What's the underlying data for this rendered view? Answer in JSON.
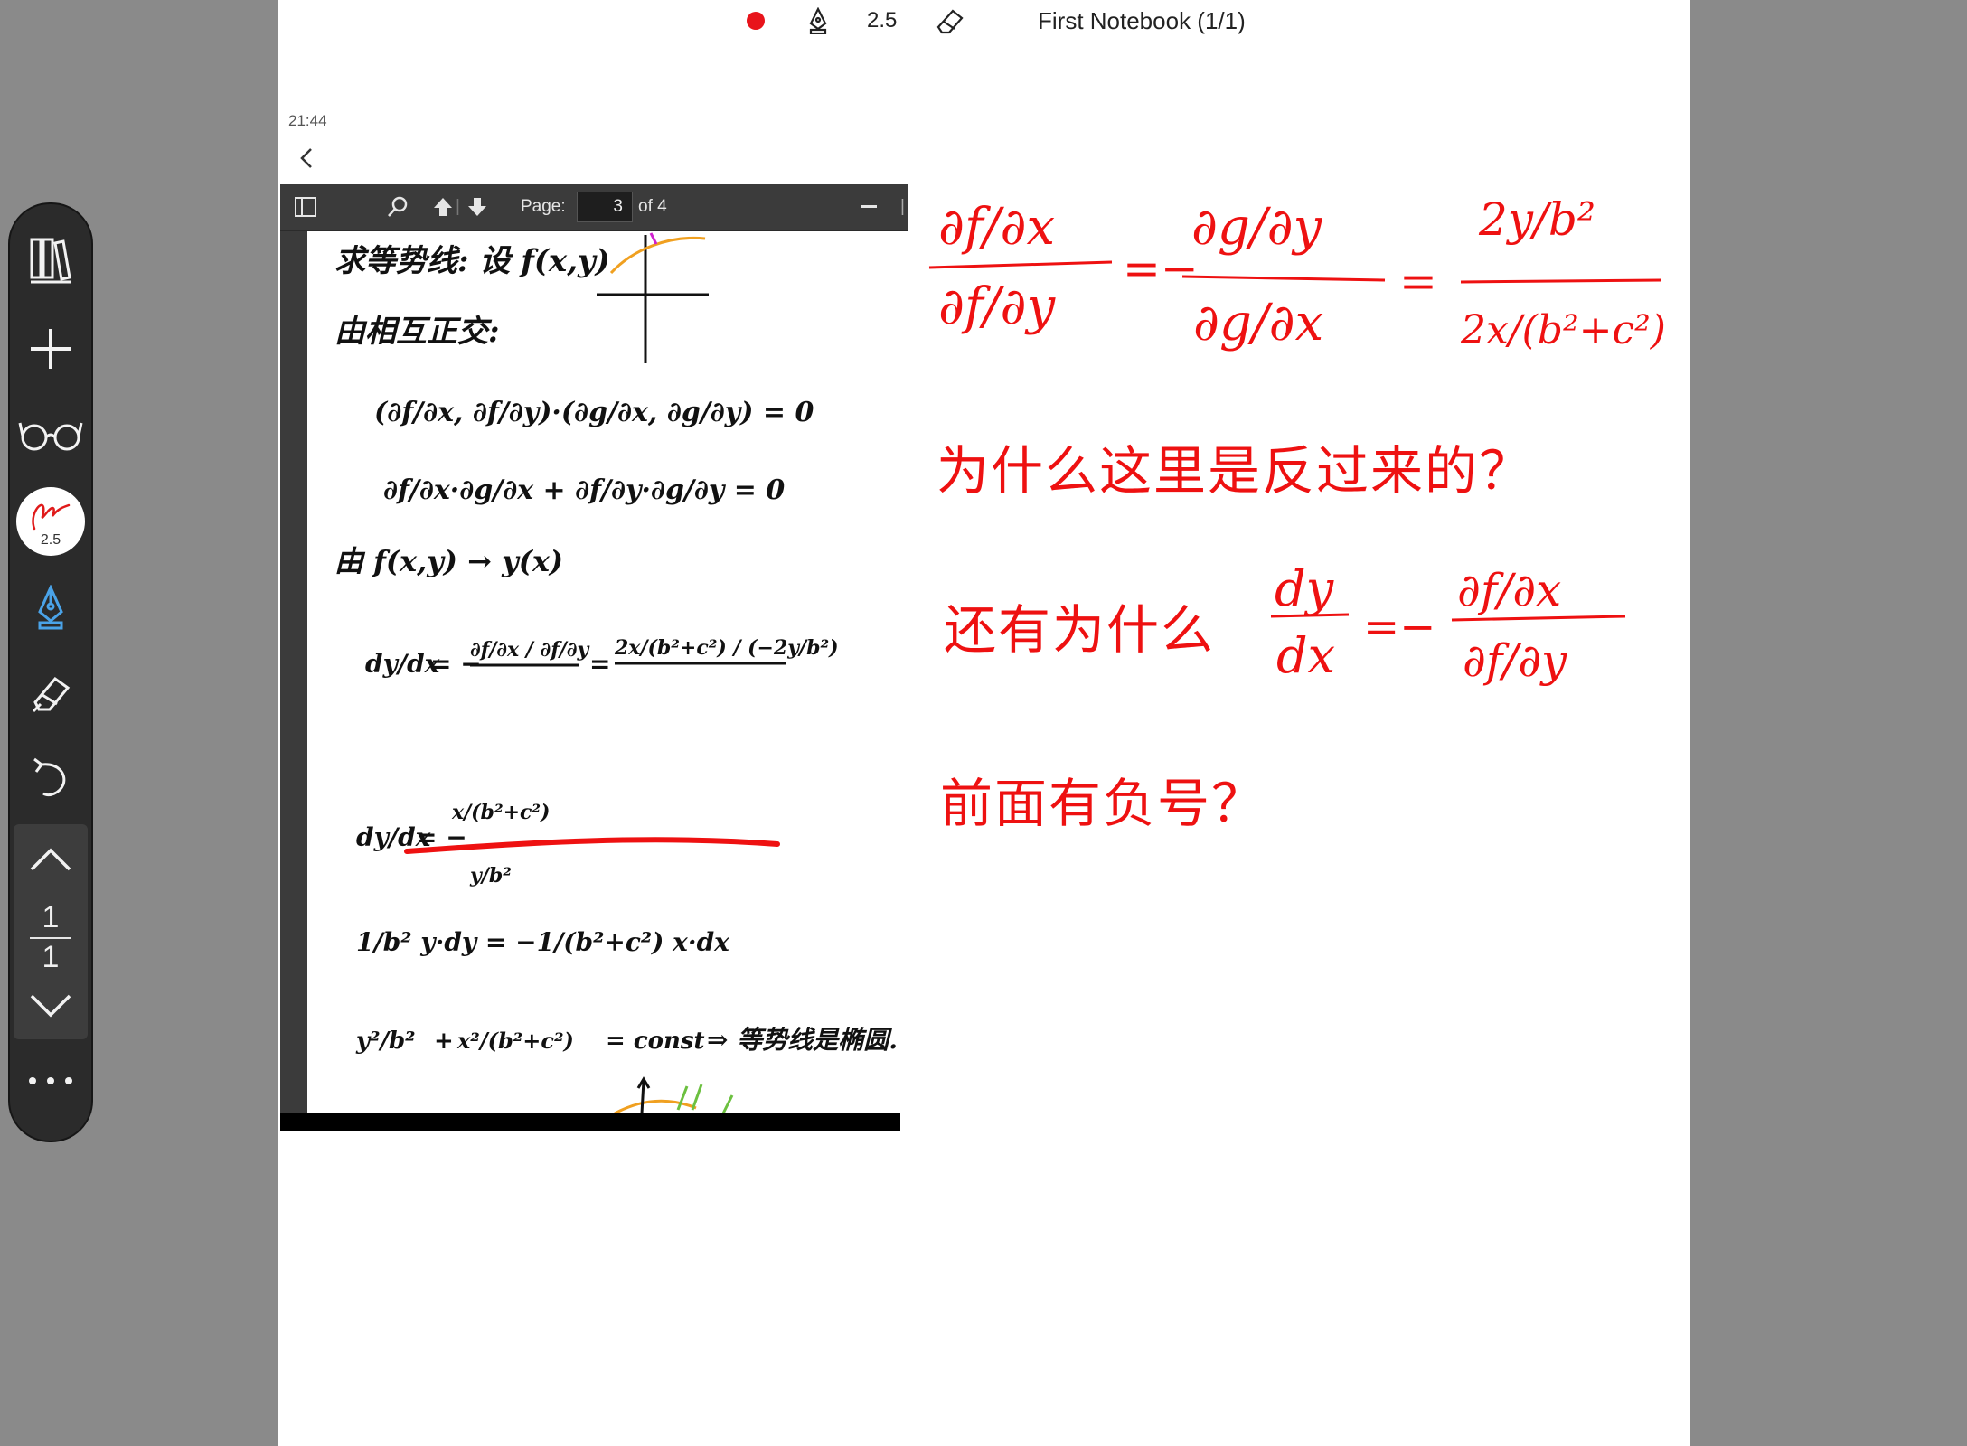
{
  "topbar": {
    "pen_size": "2.5",
    "notebook_title": "First Notebook (1/1)",
    "record_color": "#e8141b"
  },
  "device": {
    "time": "21:44"
  },
  "pdf_viewer": {
    "page_label": "Page:",
    "page_current": "3",
    "page_of": "of 4",
    "icons": [
      "sidebar-toggle-icon",
      "search-icon",
      "previous-page-icon",
      "next-page-icon",
      "zoom-out-icon"
    ]
  },
  "sidebar": {
    "pen_size": "2.5",
    "page_current": "1",
    "page_total": "1",
    "accent": "#4aa3e8"
  },
  "pdf_notes": {
    "line1": "求等势线: 设 f(x,y)",
    "line2": "由相互正交:",
    "line3": "(∂f/∂x, ∂f/∂y)·(∂g/∂x, ∂g/∂y) = 0",
    "line4": "∂f/∂x·∂g/∂x + ∂f/∂y·∂g/∂y = 0",
    "line5": "由 f(x,y) → y(x)",
    "line6_lhs": "dy/dx",
    "line6_mid": "∂f/∂x / ∂f/∂y",
    "line6_rhs": "2x/(b²+c²) / (−2y/b²)",
    "line7_lhs": "dy/dx",
    "line7_num": "x/(b²+c²)",
    "line7_den": "y/b²",
    "line8": "1/b² y·dy = −1/(b²+c²) x·dx",
    "line9_a": "y²/b²",
    "line9_b": "x²/(b²+c²)",
    "line9_c": "= const",
    "line9_d": "⇒ 等势线是椭圆."
  },
  "annotations": {
    "eq1_a_num": "∂f/∂x",
    "eq1_a_den": "∂f/∂y",
    "eq1_eq1": "=−",
    "eq1_b_num": "∂g/∂y",
    "eq1_b_den": "∂g/∂x",
    "eq1_eq2": "=",
    "eq1_c_num": "2y/b²",
    "eq1_c_den": "2x/(b²+c²)",
    "question1": "为什么这里是反过来的？",
    "question2": "还有为什么",
    "eq2_num": "dy",
    "eq2_den": "dx",
    "eq2_eq": "=−",
    "eq2_r_num": "∂f/∂x",
    "eq2_r_den": "∂f/∂y",
    "question3": "前面有负号？",
    "ink_color": "#ee1111"
  }
}
